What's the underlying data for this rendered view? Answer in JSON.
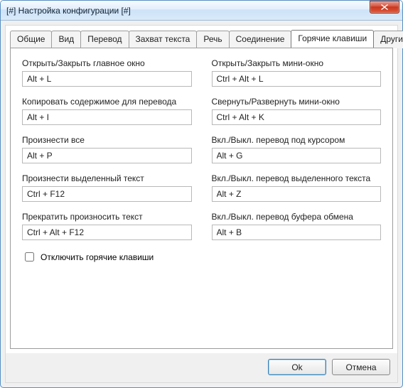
{
  "window": {
    "title": "[#] Настройка конфигурации [#]"
  },
  "tabs": [
    {
      "id": "general",
      "label": "Общие"
    },
    {
      "id": "view",
      "label": "Вид"
    },
    {
      "id": "translate",
      "label": "Перевод"
    },
    {
      "id": "capture",
      "label": "Захват текста"
    },
    {
      "id": "speech",
      "label": "Речь"
    },
    {
      "id": "connection",
      "label": "Соединение"
    },
    {
      "id": "hotkeys",
      "label": "Горячие клавиши",
      "active": true
    },
    {
      "id": "other",
      "label": "Другие"
    }
  ],
  "hotkeys": {
    "left": [
      {
        "label": "Открыть/Закрыть главное окно",
        "value": "Alt + L"
      },
      {
        "label": "Копировать содержимое для перевода",
        "value": "Alt + I"
      },
      {
        "label": "Произнести все",
        "value": "Alt + P"
      },
      {
        "label": "Произнести выделенный текст",
        "value": "Ctrl + F12"
      },
      {
        "label": "Прекратить произносить текст",
        "value": "Ctrl + Alt + F12"
      }
    ],
    "right": [
      {
        "label": "Открыть/Закрыть мини-окно",
        "value": "Ctrl + Alt + L"
      },
      {
        "label": "Свернуть/Развернуть мини-окно",
        "value": "Ctrl + Alt + K"
      },
      {
        "label": "Вкл./Выкл. перевод под курсором",
        "value": "Alt + G"
      },
      {
        "label": "Вкл./Выкл. перевод выделенного текста",
        "value": "Alt + Z"
      },
      {
        "label": "Вкл./Выкл. перевод буфера обмена",
        "value": "Alt + B"
      }
    ],
    "disable_label": "Отключить горячие клавиши",
    "disable_checked": false
  },
  "buttons": {
    "ok": "Ok",
    "cancel": "Отмена"
  }
}
